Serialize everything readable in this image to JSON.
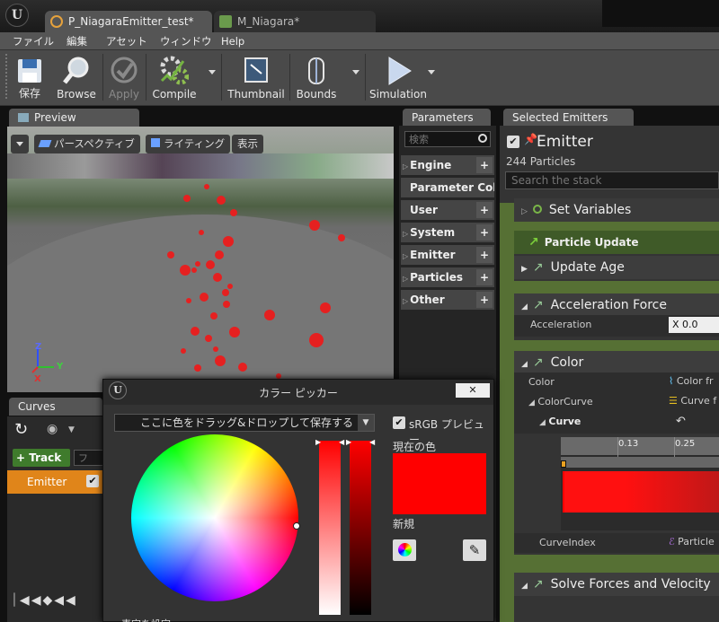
{
  "tabs": [
    {
      "label": "P_NiagaraEmitter_test*",
      "icon": "niagara-emitter-icon"
    },
    {
      "label": "M_Niagara*",
      "icon": "material-icon"
    }
  ],
  "menu": [
    "ファイル",
    "編集",
    "アセット",
    "ウィンドウ",
    "Help"
  ],
  "toolbar": {
    "save": "保存",
    "browse": "Browse",
    "apply": "Apply",
    "compile": "Compile",
    "thumbnail": "Thumbnail",
    "bounds": "Bounds",
    "simulation": "Simulation"
  },
  "preview": {
    "tab": "Preview",
    "perspective": "パースペクティブ",
    "lighting": "ライティング",
    "show": "表示",
    "axis_x": "X",
    "axis_y": "Y",
    "axis_z": "Z"
  },
  "params": {
    "tab": "Parameters",
    "search_placeholder": "検索",
    "items": [
      "Engine",
      "Parameter Collec",
      "User",
      "System",
      "Emitter",
      "Particles",
      "Other"
    ]
  },
  "emitter": {
    "tab": "Selected Emitters",
    "title": "Emitter",
    "count": "244 Particles",
    "search_placeholder": "Search the stack"
  },
  "stack": {
    "set_variables": "Set Variables",
    "particle_update": "Particle Update",
    "update_age": "Update Age",
    "acceleration_force": "Acceleration Force",
    "acceleration_label": "Acceleration",
    "acceleration_x_label": "X",
    "acceleration_x": "0.0",
    "color": "Color",
    "color_label": "Color",
    "color_value": "Color fr",
    "color_curve_label": "ColorCurve",
    "color_curve_value": "Curve f",
    "curve_label": "Curve",
    "tick_1": "0.13",
    "tick_2": "0.25",
    "curve_index_label": "CurveIndex",
    "curve_index_value": "Particle",
    "solve_forces": "Solve Forces and Velocity"
  },
  "curves": {
    "tab": "Curves",
    "track": "Track",
    "filter_placeholder": "フ",
    "emitter_row": "Emitter"
  },
  "picker": {
    "title": "カラー ピッカー",
    "close": "✕",
    "dropdown": "ここに色をドラッグ&ドロップして保存する",
    "srgb": "sRGB プレビュー",
    "current": "現在の色",
    "new": "新規",
    "current_color": "#ff0000",
    "new_color": "#ff0000",
    "truncated_bottom": "表定を設定"
  }
}
